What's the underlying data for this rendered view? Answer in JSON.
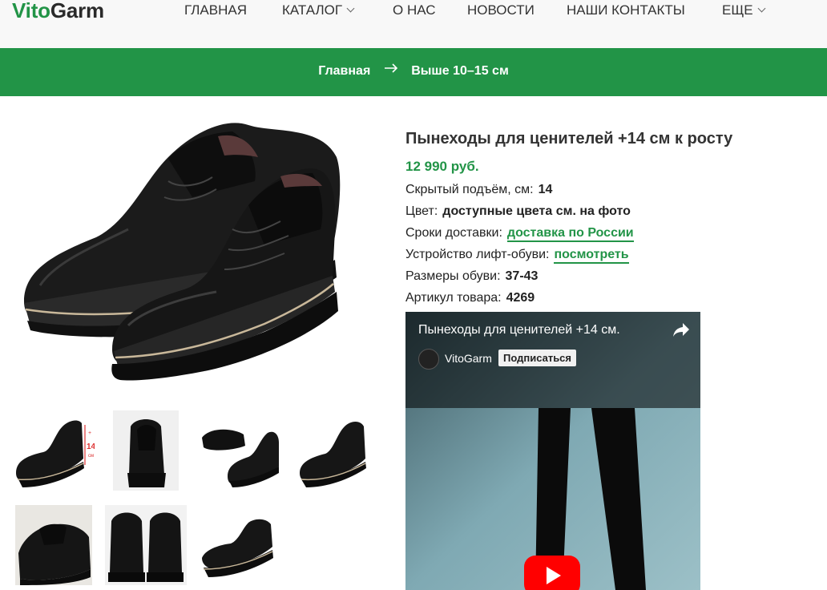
{
  "header": {
    "logo_part1": "Vito",
    "logo_part2": "Garm",
    "nav": [
      {
        "label": "ГЛАВНАЯ"
      },
      {
        "label": "КАТАЛОГ"
      },
      {
        "label": "О НАС"
      },
      {
        "label": "НОВОСТИ"
      },
      {
        "label": "НАШИ КОНТАКТЫ"
      },
      {
        "label": "ЕЩЕ"
      }
    ]
  },
  "breadcrumb": {
    "home": "Главная",
    "current": "Выше 10–15 см"
  },
  "product": {
    "title": "Пынеходы для ценителей +14 см к росту",
    "price": "12 990 руб.",
    "lift_label": "Скрытый подъём, см:",
    "lift_value": "14",
    "color_label": "Цвет:",
    "color_value": "доступные цвета см. на фото",
    "delivery_label": "Сроки доставки:",
    "delivery_link": "доставка по России",
    "device_label": "Устройство лифт-обуви:",
    "device_link": "посмотреть",
    "sizes_label": "Размеры обуви:",
    "sizes_value": "37-43",
    "sku_label": "Артикул товара:",
    "sku_value": "4269"
  },
  "thumbs": {
    "badge_plus": "+",
    "badge_num": "14",
    "badge_unit": "см"
  },
  "video": {
    "title": "Пынеходы для ценителей +14 см.",
    "channel": "VitoGarm",
    "subscribe_label": "Подписаться"
  },
  "colors": {
    "brand_green": "#229447",
    "header_bg": "#f8f8f8",
    "video_bg": "#6f9aa5"
  }
}
